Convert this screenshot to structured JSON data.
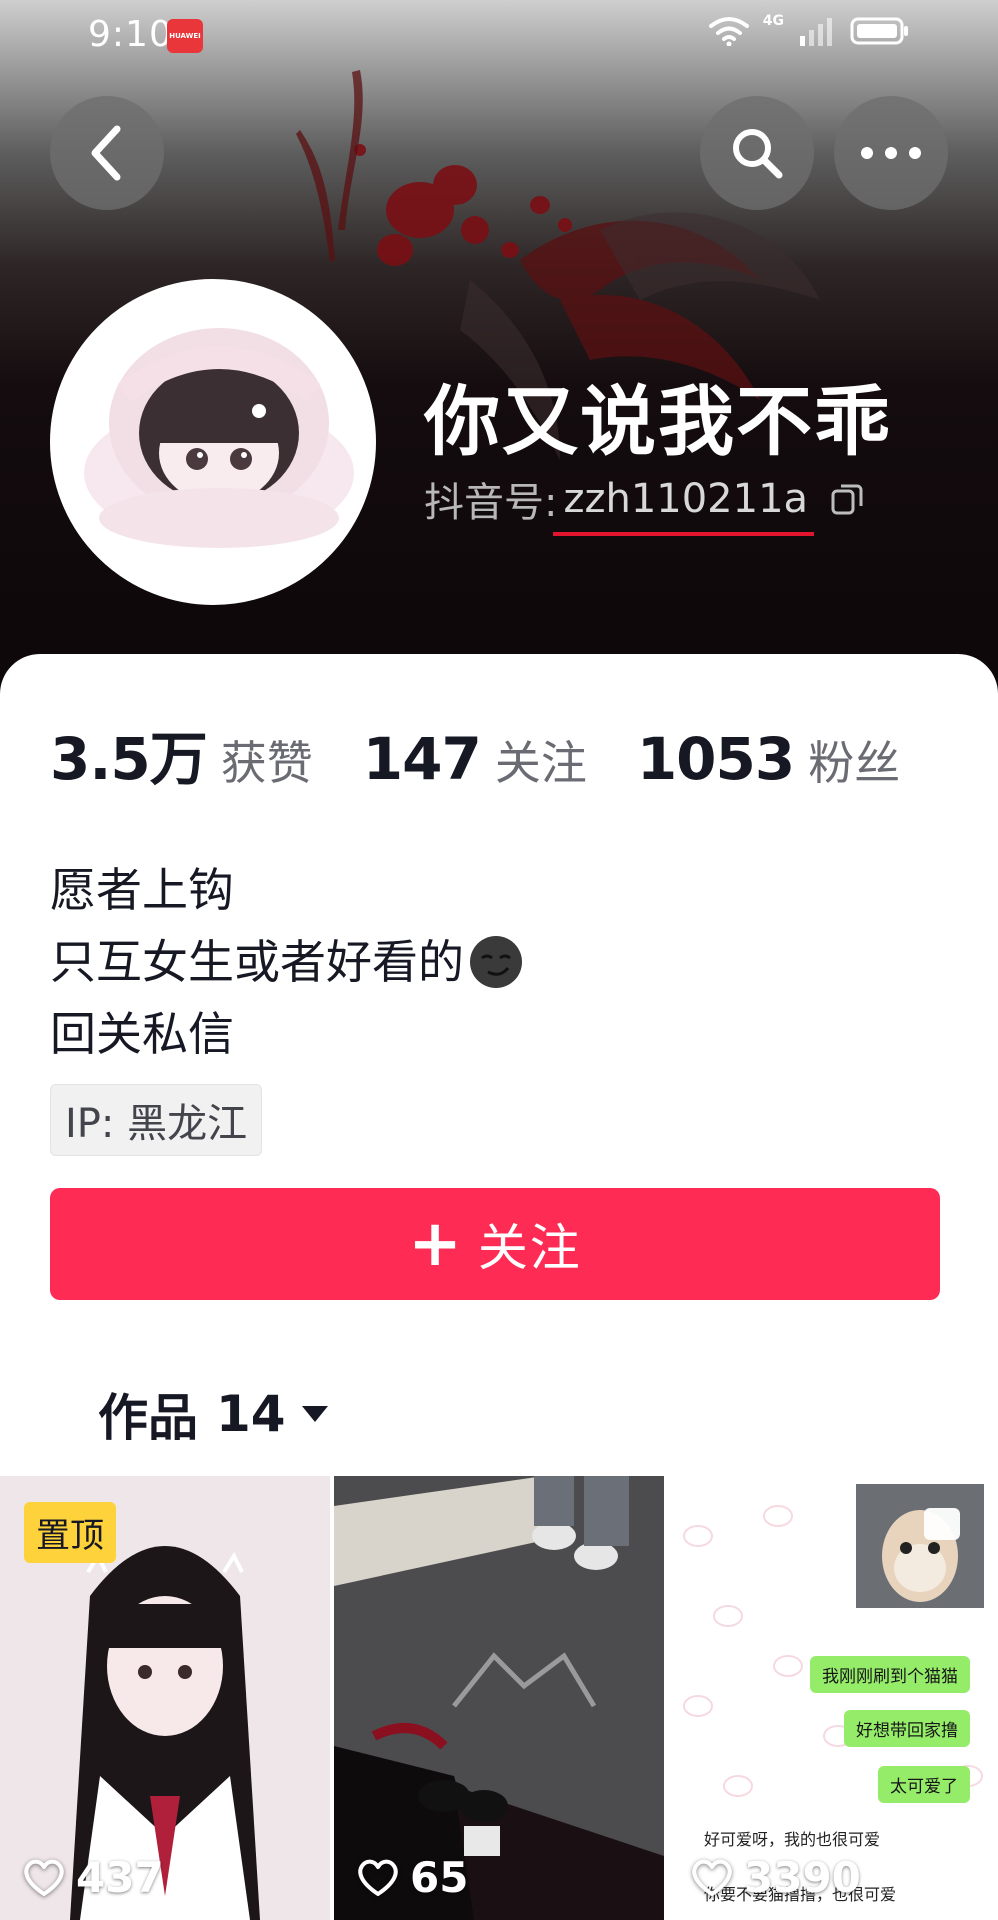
{
  "status_bar": {
    "time": "9:10",
    "huawei_badge": "HUAWEI",
    "network": "4G"
  },
  "icons": {
    "back": "chevron-left-icon",
    "search": "search-icon",
    "more": "more-dots-icon",
    "copy": "copy-icon",
    "heart": "heart-outline-icon"
  },
  "profile": {
    "nickname": "你又说我不乖",
    "id_label": "抖音号:",
    "id_value": "zzh110211a"
  },
  "stats": [
    {
      "value": "3.5万",
      "label": "获赞"
    },
    {
      "value": "147",
      "label": "关注"
    },
    {
      "value": "1053",
      "label": "粉丝"
    }
  ],
  "bio": {
    "line1": "愿者上钩",
    "line2": "只互女生或者好看的",
    "line3": "回关私信"
  },
  "ip_tag": "IP: 黑龙江",
  "follow_button": {
    "plus": "+",
    "label": "关注"
  },
  "works_tab": {
    "label": "作品",
    "count": "14"
  },
  "videos": [
    {
      "badge": "置顶",
      "likes": "437"
    },
    {
      "likes": "65"
    },
    {
      "likes": "3390",
      "chat": {
        "bubble1": "我刚刚刷到个猫猫",
        "bubble2": "好想带回家撸",
        "bubble3": "太可爱了",
        "reply1": "好可爱呀，我的也很可爱",
        "reply2": "你要不要猫撸撸，也很可爱"
      }
    }
  ],
  "colors": {
    "accent": "#fe2c55",
    "pin_badge": "#fdd23a",
    "id_underline": "#e3152e",
    "text_primary": "#161823",
    "text_secondary": "#6b6c73"
  }
}
